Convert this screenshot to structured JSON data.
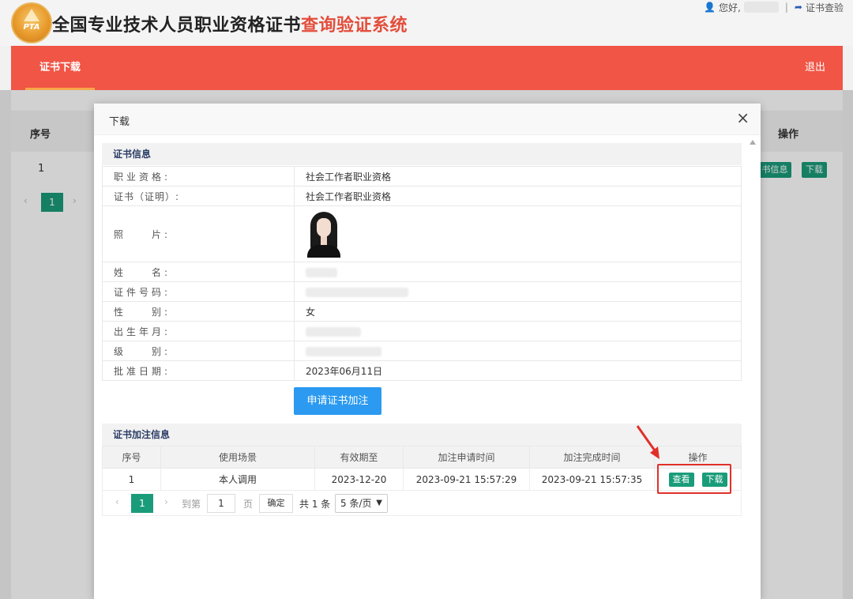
{
  "header": {
    "logo_text": "PTA",
    "title_main": "全国专业技术人员职业资格证书",
    "title_accent": "查询验证系统",
    "greeting": "您好,",
    "separator": "|",
    "verify_link": "证书查验"
  },
  "nav": {
    "active_tab": "证书下载",
    "logout": "退出"
  },
  "background_table": {
    "columns": [
      "序号",
      "操作"
    ],
    "row_number": "1",
    "info_button": "书信息",
    "download_button": "下载",
    "pager_current": "1",
    "pager_prev": "‹",
    "pager_next": "›"
  },
  "modal": {
    "title": "下载",
    "close": "×",
    "cert_section_title": "证书信息",
    "fields": [
      {
        "label": "职业资格:",
        "value": "社会工作者职业资格"
      },
      {
        "label": "证书（证明）:",
        "value": "社会工作者职业资格"
      },
      {
        "label": "照　　片:",
        "value": ""
      },
      {
        "label": "姓　　名:",
        "value": ""
      },
      {
        "label": "证件号码:",
        "value": ""
      },
      {
        "label": "性　　别:",
        "value": "女"
      },
      {
        "label": "出生年月:",
        "value": ""
      },
      {
        "label": "级　　别:",
        "value": ""
      },
      {
        "label": "批准日期:",
        "value": "2023年06月11日"
      }
    ],
    "apply_button": "申请证书加注",
    "annotation_section_title": "证书加注信息",
    "annotation_columns": [
      "序号",
      "使用场景",
      "有效期至",
      "加注申请时间",
      "加注完成时间",
      "操作"
    ],
    "annotation_rows": [
      {
        "no": "1",
        "scene": "本人调用",
        "valid_until": "2023-12-20",
        "apply_time": "2023-09-21 15:57:29",
        "complete_time": "2023-09-21 15:57:35",
        "view": "查看",
        "download": "下载"
      }
    ],
    "pager": {
      "prev": "‹",
      "current": "1",
      "next": "›",
      "goto_label": "到第",
      "goto_value": "1",
      "page_label": "页",
      "confirm": "确定",
      "total": "共 1 条",
      "page_size": "5 条/页"
    }
  },
  "colors": {
    "nav_red": "#f05545",
    "accent_red": "#e34d3c",
    "teal": "#1a9c7a",
    "blue_button": "#2b9af0",
    "highlight_red": "#e0302a"
  }
}
